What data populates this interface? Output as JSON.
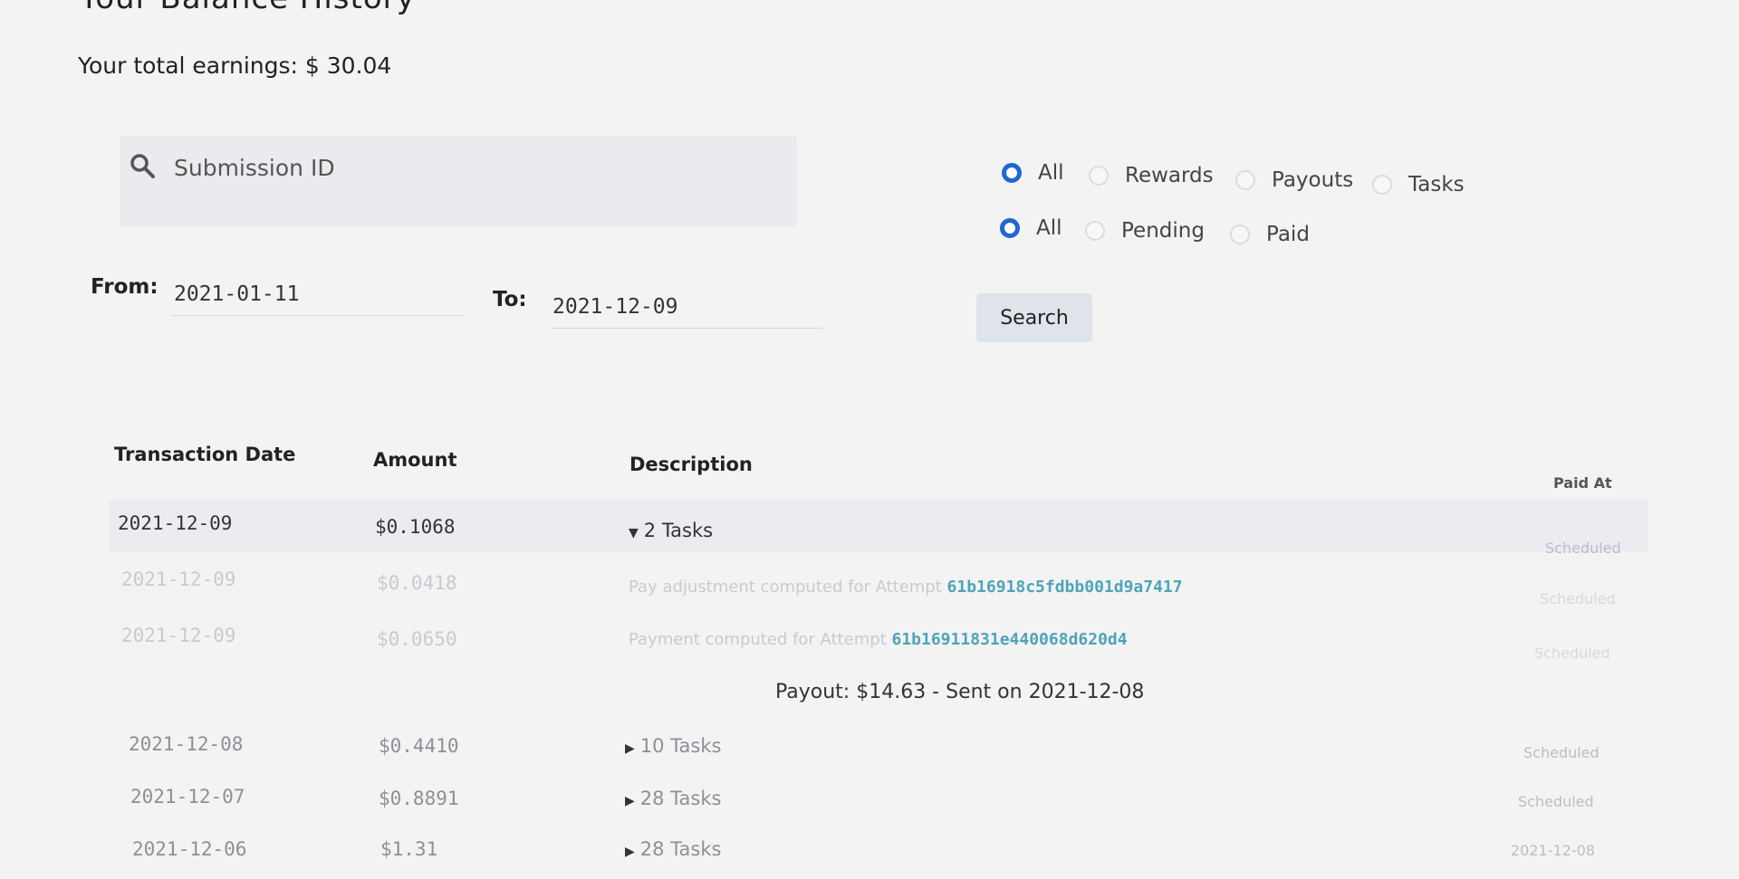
{
  "page": {
    "title": "Your Balance History",
    "total_earnings": "Your total earnings: $ 30.04"
  },
  "search": {
    "placeholder": "Submission ID",
    "icon": "search-icon"
  },
  "filters": {
    "type": [
      {
        "label": "All",
        "checked": true
      },
      {
        "label": "Rewards",
        "checked": false
      },
      {
        "label": "Payouts",
        "checked": false
      },
      {
        "label": "Tasks",
        "checked": false
      }
    ],
    "status": [
      {
        "label": "All",
        "checked": true
      },
      {
        "label": "Pending",
        "checked": false
      },
      {
        "label": "Paid",
        "checked": false
      }
    ]
  },
  "date_range": {
    "from_label": "From:",
    "from_value": "2021-01-11",
    "to_label": "To:",
    "to_value": "2021-12-09",
    "search_button": "Search"
  },
  "table": {
    "headers": {
      "date": "Transaction Date",
      "amount": "Amount",
      "description": "Description",
      "paid_at": "Paid At"
    },
    "rows": [
      {
        "date": "2021-12-09",
        "amount": "$0.1068",
        "description": "2 Tasks",
        "paid_at": "Scheduled"
      },
      {
        "date": "2021-12-09",
        "amount": "$0.0418",
        "description_prefix": "Pay adjustment computed for Attempt",
        "attempt_id": "61b16918c5fdbb001d9a7417",
        "paid_at": "Scheduled"
      },
      {
        "date": "2021-12-09",
        "amount": "$0.0650",
        "description_prefix": "Payment computed for Attempt",
        "attempt_id": "61b16911831e440068d620d4",
        "paid_at": "Scheduled"
      },
      {
        "date": "2021-12-08",
        "amount": "$0.4410",
        "description": "10 Tasks",
        "paid_at": "Scheduled"
      },
      {
        "date": "2021-12-07",
        "amount": "$0.8891",
        "description": "28 Tasks",
        "paid_at": "Scheduled"
      },
      {
        "date": "2021-12-06",
        "amount": "$1.31",
        "description": "28 Tasks",
        "paid_at": "2021-12-08"
      }
    ],
    "payout_row": "Payout: $14.63 - Sent on 2021-12-08"
  }
}
